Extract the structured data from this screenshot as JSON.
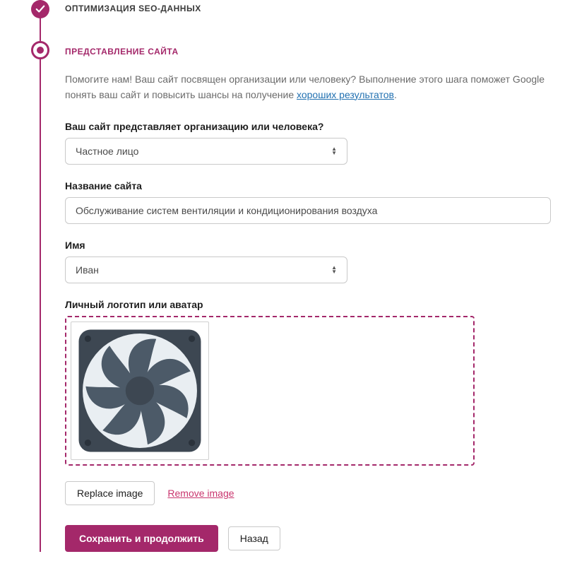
{
  "steps": {
    "prev_title": "ОПТИМИЗАЦИЯ SEO-ДАННЫХ",
    "current_title": "ПРЕДСТАВЛЕНИЕ САЙТА"
  },
  "intro": {
    "text_before": "Помогите нам! Ваш сайт посвящен организации или человеку? Выполнение этого шага поможет Google понять ваш сайт и повысить шансы на получение ",
    "link_text": "хороших результатов",
    "text_after": "."
  },
  "fields": {
    "represents": {
      "label": "Ваш сайт представляет организацию или человека?",
      "value": "Частное лицо"
    },
    "site_name": {
      "label": "Название сайта",
      "value": "Обслуживание систем вентиляции и кондиционирования воздуха"
    },
    "person_name": {
      "label": "Имя",
      "value": "Иван"
    },
    "avatar": {
      "label": "Личный логотип или аватар"
    }
  },
  "buttons": {
    "replace_image": "Replace image",
    "remove_image": "Remove image",
    "save_continue": "Сохранить и продолжить",
    "back": "Назад"
  }
}
